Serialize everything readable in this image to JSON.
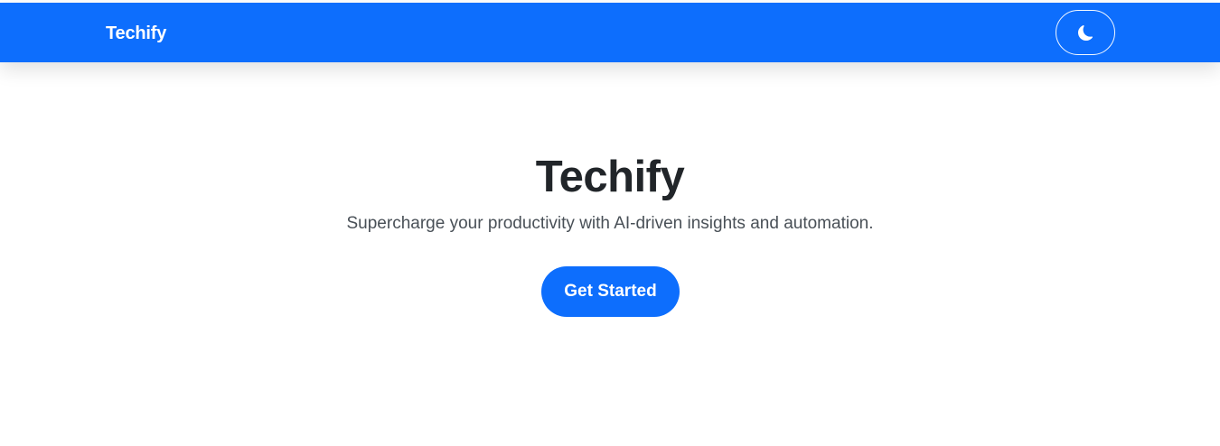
{
  "navbar": {
    "brand": "Techify",
    "theme_toggle": {
      "icon": "moon-icon"
    }
  },
  "hero": {
    "title": "Techify",
    "subtitle": "Supercharge your productivity with AI-driven insights and automation.",
    "cta_label": "Get Started"
  },
  "colors": {
    "primary": "#0d6efd",
    "heading": "#212529",
    "body_text": "#495057",
    "background": "#ffffff"
  }
}
